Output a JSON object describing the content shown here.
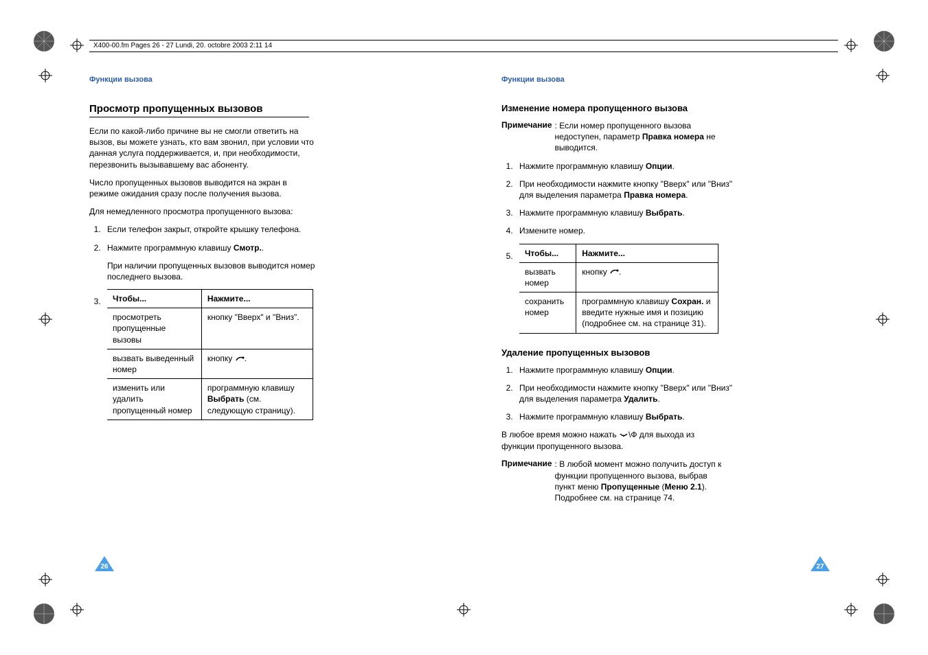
{
  "header": "X400-00.fm  Pages 26 - 27  Lundi, 20. octobre 2003  2:11 14",
  "section_header": "Функции вызова",
  "left": {
    "title": "Просмотр пропущенных вызовов",
    "p1": "Если по какой-либо причине вы не смогли ответить на вызов, вы можете узнать, кто вам звонил, при условии что данная услуга поддерживается, и, при необходимости, перезвонить вызывавшему вас абоненту.",
    "p2": "Число пропущенных вызовов выводится на экран в режиме ожидания сразу после получения вызова.",
    "p3": "Для немедленного просмотра пропущенного вызова:",
    "step1": "Если телефон закрыт, откройте крышку телефона.",
    "step2_a": "Нажмите программную клавишу ",
    "step2_b": "Смотр.",
    "step2_c": ".",
    "step2_sub": "При наличии пропущенных вызовов выводится номер последнего вызова.",
    "table": {
      "h1": "Чтобы...",
      "h2": "Нажмите...",
      "r1c1": "просмотреть пропущенные вызовы",
      "r1c2": "кнопку \"Вверх\" и \"Вниз\".",
      "r2c1": "вызвать выведенный номер",
      "r2c2a": "кнопку ",
      "r2c2b": ".",
      "r3c1": "изменить или удалить пропущенный номер",
      "r3c2a": "программную клавишу ",
      "r3c2b": "Выбрать",
      "r3c2c": " (см. следующую страницу)."
    },
    "page_num": "26"
  },
  "right": {
    "sub1": "Изменение номера пропущенного вызова",
    "note1_label": "Примечание",
    "note1_text_a": ": Если номер пропущенного вызова недоступен, параметр ",
    "note1_text_b": "Правка номера",
    "note1_text_c": " не выводится.",
    "s1_1a": "Нажмите программную клавишу ",
    "s1_1b": "Опции",
    "s1_1c": ".",
    "s1_2a": "При необходимости нажмите кнопку \"Вверх\" или \"Вниз\" для выделения параметра ",
    "s1_2b": "Правка номера",
    "s1_2c": ".",
    "s1_3a": "Нажмите программную клавишу ",
    "s1_3b": "Выбрать",
    "s1_3c": ".",
    "s1_4": "Измените номер.",
    "table": {
      "h1": "Чтобы...",
      "h2": "Нажмите...",
      "r1c1": "вызвать номер",
      "r1c2a": "кнопку ",
      "r1c2b": ".",
      "r2c1": "сохранить номер",
      "r2c2a": "программную клавишу ",
      "r2c2b": "Сохран.",
      "r2c2c": " и введите нужные имя и позицию (подробнее см. на странице 31)."
    },
    "sub2": "Удаление пропущенных вызовов",
    "s2_1a": "Нажмите программную клавишу ",
    "s2_1b": "Опции",
    "s2_1c": ".",
    "s2_2a": "При необходимости нажмите кнопку \"Вверх\" или \"Вниз\" для выделения параметра ",
    "s2_2b": "Удалить",
    "s2_2c": ".",
    "s2_3a": "Нажмите программную клавишу ",
    "s2_3b": "Выбрать",
    "s2_3c": ".",
    "exit_a": "В любое время можно нажать ",
    "exit_b": " для выхода из функции пропущенного вызова.",
    "note2_label": "Примечание",
    "note2_a": ": В любой момент можно получить доступ к функции пропущенного вызова, выбрав пункт меню ",
    "note2_b": "Пропущенные",
    "note2_c": " (",
    "note2_d": "Меню 2.1",
    "note2_e": "). Подробнее см. на странице 74.",
    "page_num": "27"
  }
}
